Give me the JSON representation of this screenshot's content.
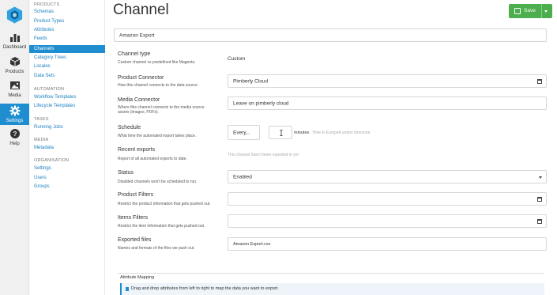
{
  "rail": {
    "items": [
      {
        "label": "Dashboard",
        "icon": "bar-chart-icon"
      },
      {
        "label": "Products",
        "icon": "box-icon"
      },
      {
        "label": "Media",
        "icon": "image-icon"
      },
      {
        "label": "Settings",
        "icon": "gear-icon"
      },
      {
        "label": "Help",
        "icon": "help-icon"
      }
    ]
  },
  "nav": {
    "products_heading": "PRODUCTS",
    "products": [
      "Schemas",
      "Product Types",
      "Attributes",
      "Feeds",
      "Channels",
      "Category Trees",
      "Locales",
      "Data Sets"
    ],
    "automation_heading": "AUTOMATION",
    "automation": [
      "Workflow Templates",
      "Lifecycle Templates"
    ],
    "tasks_heading": "TASKS",
    "tasks": [
      "Running Jobs"
    ],
    "media_heading": "MEDIA",
    "media": [
      "Metadata"
    ],
    "organisation_heading": "ORGANISATION",
    "organisation": [
      "Settings",
      "Users",
      "Groups"
    ]
  },
  "main": {
    "title": "Channel",
    "save_label": "Save",
    "name_value": "Amazon Export",
    "channel_type": {
      "label": "Channel type",
      "desc": "Custom channel vs predefined like Magento.",
      "value": "Custom"
    },
    "product_connector": {
      "label": "Product Connector",
      "desc": "How this channel connects to the data source",
      "value": "Pimberly Cloud"
    },
    "media_connector": {
      "label": "Media Connector",
      "desc1": "Where this channel connects to the media source",
      "desc2": "assets (images, PDFs).",
      "value": "Leave on pimberly cloud"
    },
    "schedule": {
      "label": "Schedule",
      "desc": "What time the automated export takes place.",
      "every_label": "Every...",
      "minutes_label": "minutes",
      "timezone": "Time in Europe/London timezone"
    },
    "recent_exports": {
      "label": "Recent exports",
      "desc": "Report of all automated exports to date.",
      "value": "This channel hasn't been exported to yet"
    },
    "status": {
      "label": "Status",
      "desc": "Disabled channels won't be scheduled to run.",
      "value": "Enabled"
    },
    "product_filters": {
      "label": "Product Filters",
      "desc": "Restrict the product information that gets pushed out."
    },
    "items_filters": {
      "label": "Items Filters",
      "desc": "Restrict the item information that gets pushed out."
    },
    "exported_files": {
      "label": "Exported files",
      "desc": "Names and formats of the files we push out.",
      "value": "Amazon Export.csv"
    },
    "attribute_mapping": {
      "title": "Attribute Mapping",
      "info": "Drag and drop attributes from left to right to map the data you want to export."
    }
  },
  "colors": {
    "accent": "#1f8ed0",
    "save": "#4cae4c"
  }
}
